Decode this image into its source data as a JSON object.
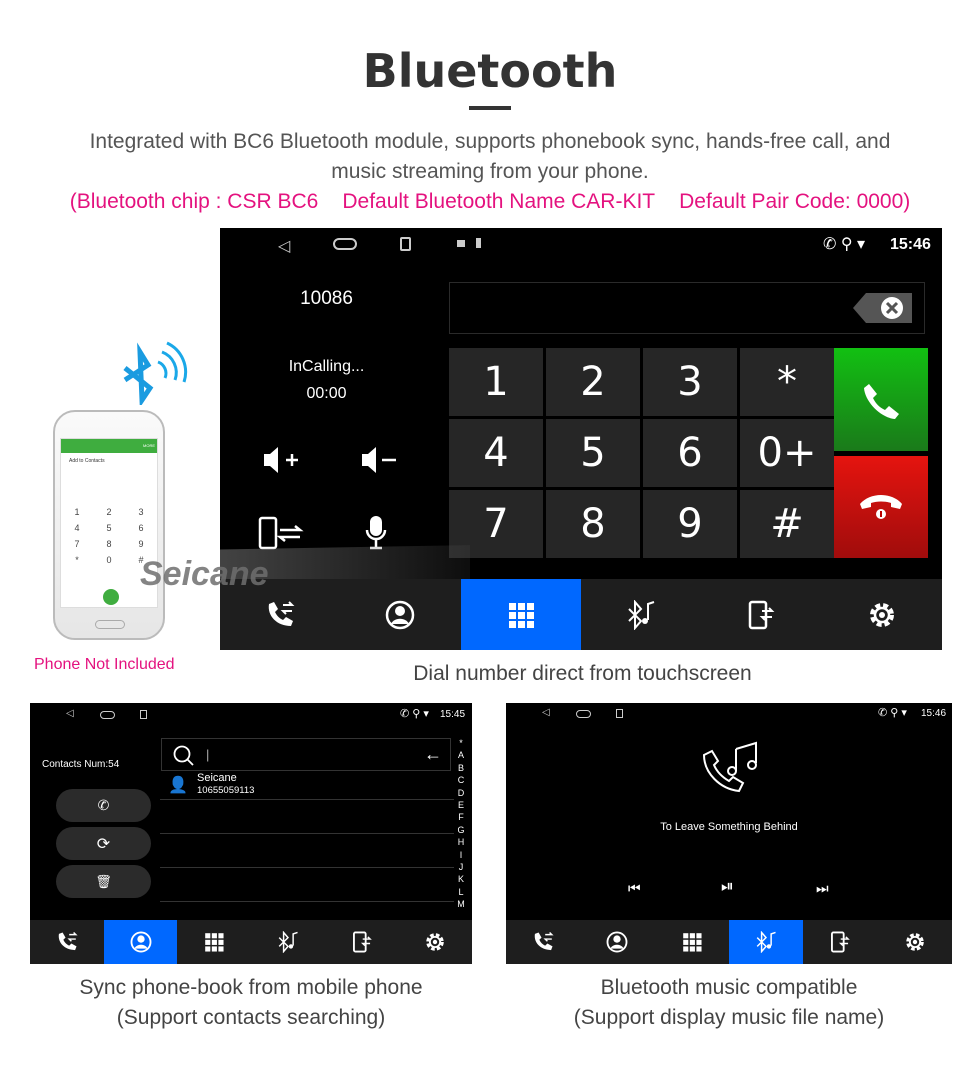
{
  "header": {
    "title": "Bluetooth",
    "desc_line1": "Integrated with BC6 Bluetooth module, supports phonebook sync, hands-free call, and",
    "desc_line2": "music streaming from your phone.",
    "spec_chip": "(Bluetooth chip : CSR BC6",
    "spec_name": "Default Bluetooth Name CAR-KIT",
    "spec_code": "Default Pair Code: 0000)"
  },
  "phone": {
    "note": "Phone Not Included",
    "watermark": "Seicane",
    "screen_label": "Add to Contacts",
    "more": "MORE",
    "keys": [
      "1",
      "2",
      "3",
      "4",
      "5",
      "6",
      "7",
      "8",
      "9",
      "*",
      "0",
      "#"
    ]
  },
  "colors": {
    "accent": "#0068ff",
    "call": "#1aa81a",
    "hangup": "#d0120e",
    "pink": "#e4127f"
  },
  "dialer": {
    "time": "15:46",
    "number": "10086",
    "status": "InCalling...",
    "duration": "00:00",
    "keys": [
      "1",
      "2",
      "3",
      "*",
      "4",
      "5",
      "6",
      "0+",
      "7",
      "8",
      "9",
      "#"
    ],
    "caption": "Dial number direct from touchscreen",
    "active_tab": "dialpad"
  },
  "contacts": {
    "time": "15:45",
    "count_label": "Contacts Num:54",
    "search_value": "|",
    "items": [
      {
        "name": "Seicane",
        "number": "10655059113"
      }
    ],
    "alphabet": [
      "*",
      "A",
      "B",
      "C",
      "D",
      "E",
      "F",
      "G",
      "H",
      "I",
      "J",
      "K",
      "L",
      "M"
    ],
    "caption_line1": "Sync phone-book from mobile phone",
    "caption_line2": "(Support contacts searching)",
    "active_tab": "contacts"
  },
  "music": {
    "time": "15:46",
    "track": "To Leave Something Behind",
    "caption_line1": "Bluetooth music compatible",
    "caption_line2": "(Support display music file name)",
    "active_tab": "bt-music"
  },
  "nav_tabs": [
    "call-log",
    "contacts",
    "dialpad",
    "bt-music",
    "phone-transfer",
    "settings"
  ]
}
